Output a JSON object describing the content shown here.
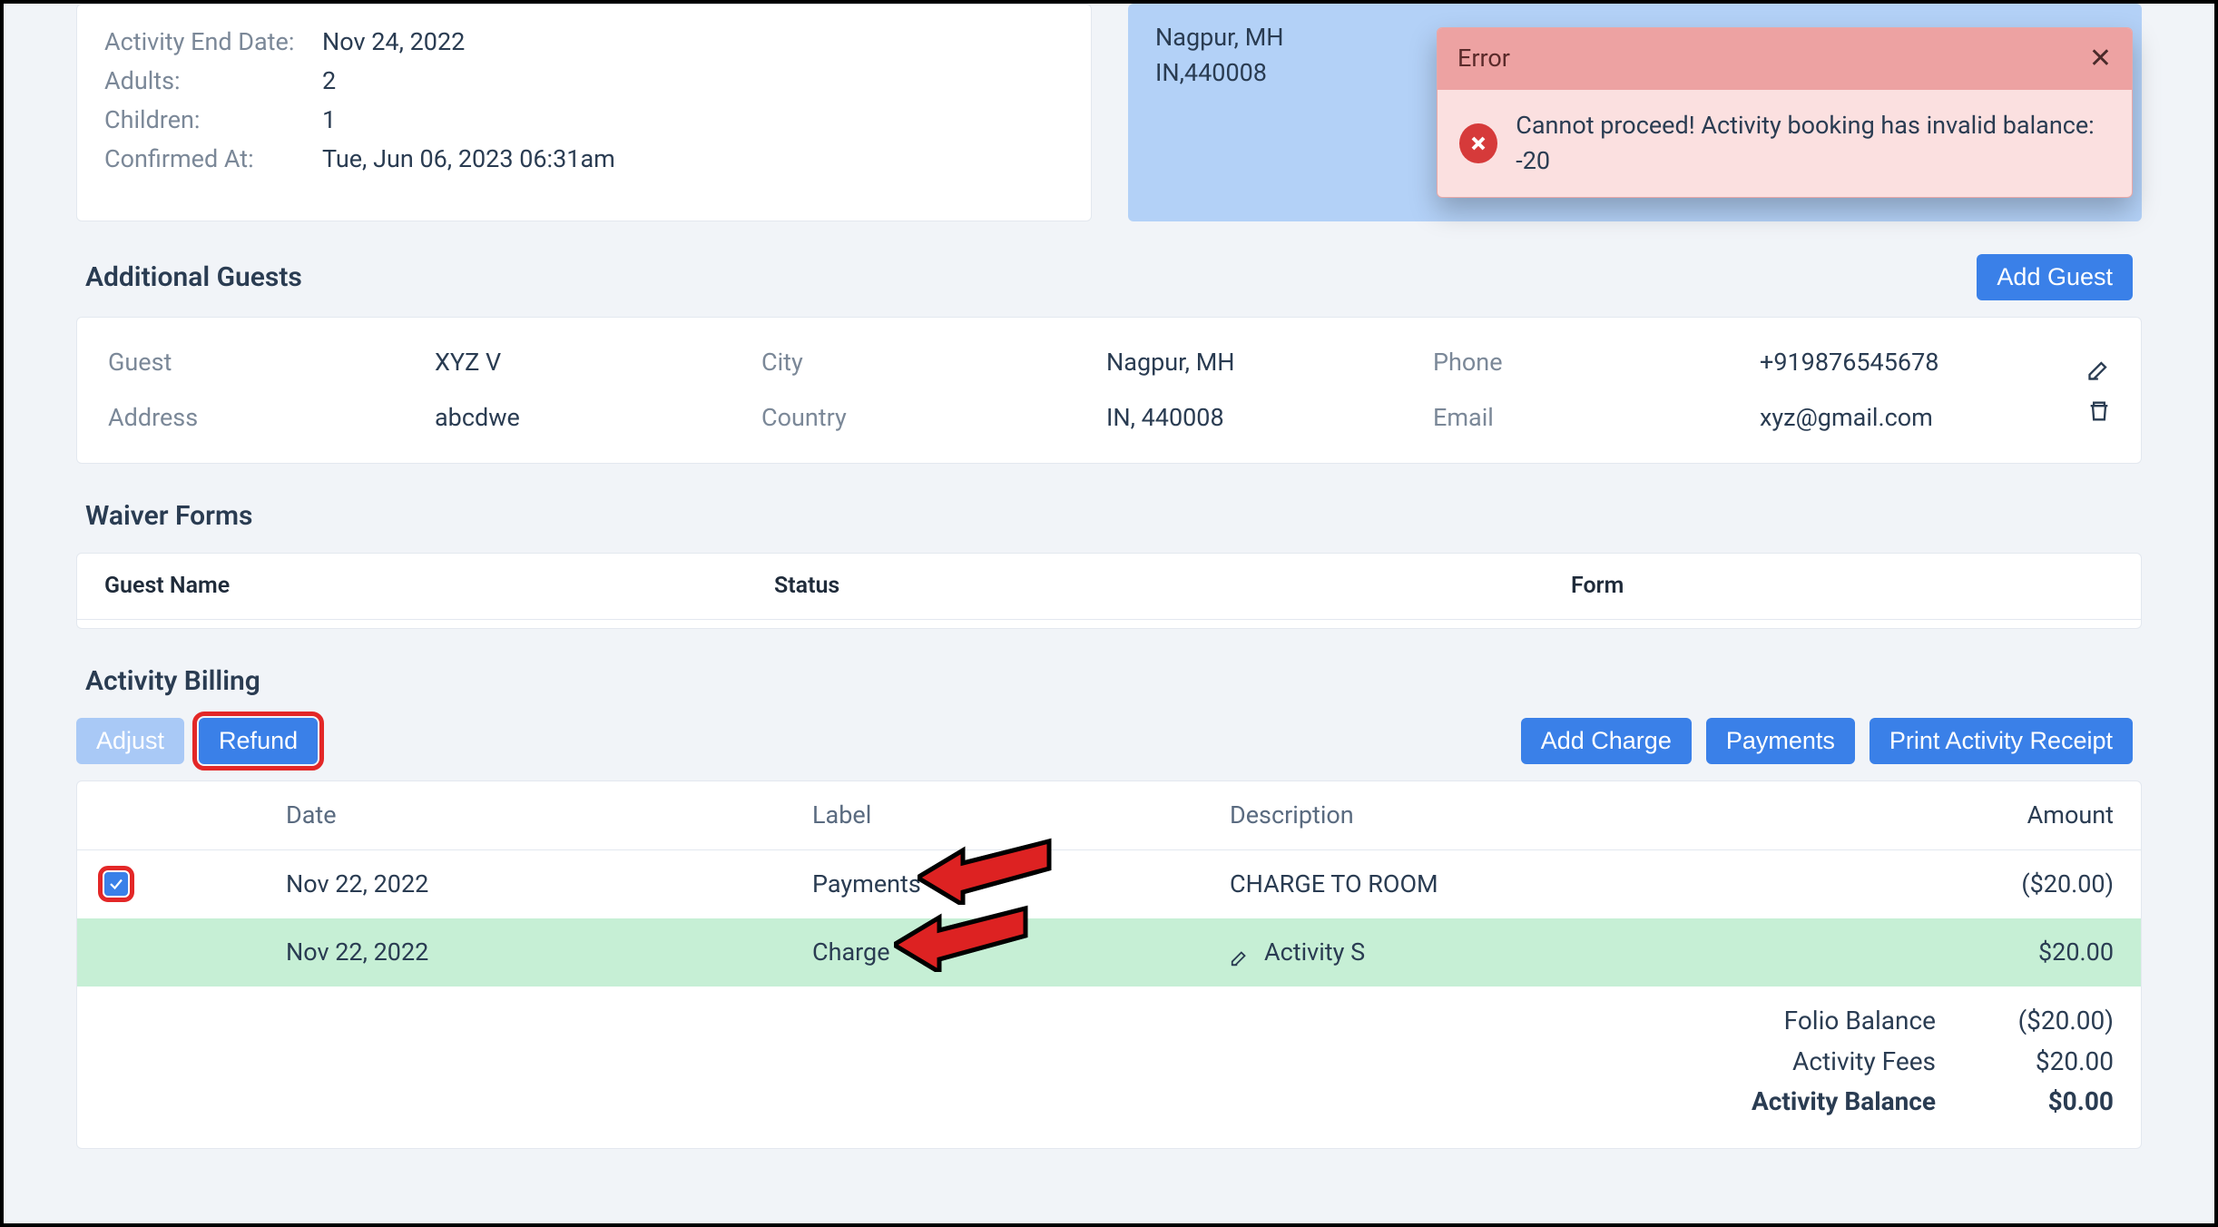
{
  "details": {
    "activity_end_date_label": "Activity End Date:",
    "activity_end_date": "Nov 24, 2022",
    "adults_label": "Adults:",
    "adults": "2",
    "children_label": "Children:",
    "children": "1",
    "confirmed_at_label": "Confirmed At:",
    "confirmed_at": "Tue, Jun 06, 2023 06:31am"
  },
  "address_panel": {
    "line1": "Nagpur, MH",
    "line2": "IN,440008"
  },
  "error_toast": {
    "title": "Error",
    "message": "Cannot proceed! Activity booking has invalid balance: -20"
  },
  "sections": {
    "additional_guests": "Additional Guests",
    "waiver_forms": "Waiver Forms",
    "activity_billing": "Activity Billing"
  },
  "buttons": {
    "add_guest": "Add Guest",
    "adjust": "Adjust",
    "refund": "Refund",
    "add_charge": "Add Charge",
    "payments": "Payments",
    "print_receipt": "Print Activity Receipt"
  },
  "guest": {
    "guest_label": "Guest",
    "guest_value": "XYZ   V",
    "city_label": "City",
    "city_value": "Nagpur, MH",
    "phone_label": "Phone",
    "phone_value": "+919876545678",
    "address_label": "Address",
    "address_value": "abcdwe",
    "country_label": "Country",
    "country_value": "IN, 440008",
    "email_label": "Email",
    "email_value": "xyz@gmail.com"
  },
  "waiver_table": {
    "col_guest_name": "Guest Name",
    "col_status": "Status",
    "col_form": "Form"
  },
  "billing": {
    "header": {
      "date": "Date",
      "label": "Label",
      "description": "Description",
      "amount": "Amount"
    },
    "rows": [
      {
        "checked": true,
        "date": "Nov 22, 2022",
        "label": "Payments",
        "description": "CHARGE TO ROOM",
        "amount": "($20.00)",
        "editable": false
      },
      {
        "checked": false,
        "date": "Nov 22, 2022",
        "label": "Charge",
        "description": "Activity S",
        "amount": "$20.00",
        "editable": true
      }
    ],
    "summary": {
      "folio_balance_label": "Folio Balance",
      "folio_balance": "($20.00)",
      "activity_fees_label": "Activity Fees",
      "activity_fees": "$20.00",
      "activity_balance_label": "Activity Balance",
      "activity_balance": "$0.00"
    }
  }
}
